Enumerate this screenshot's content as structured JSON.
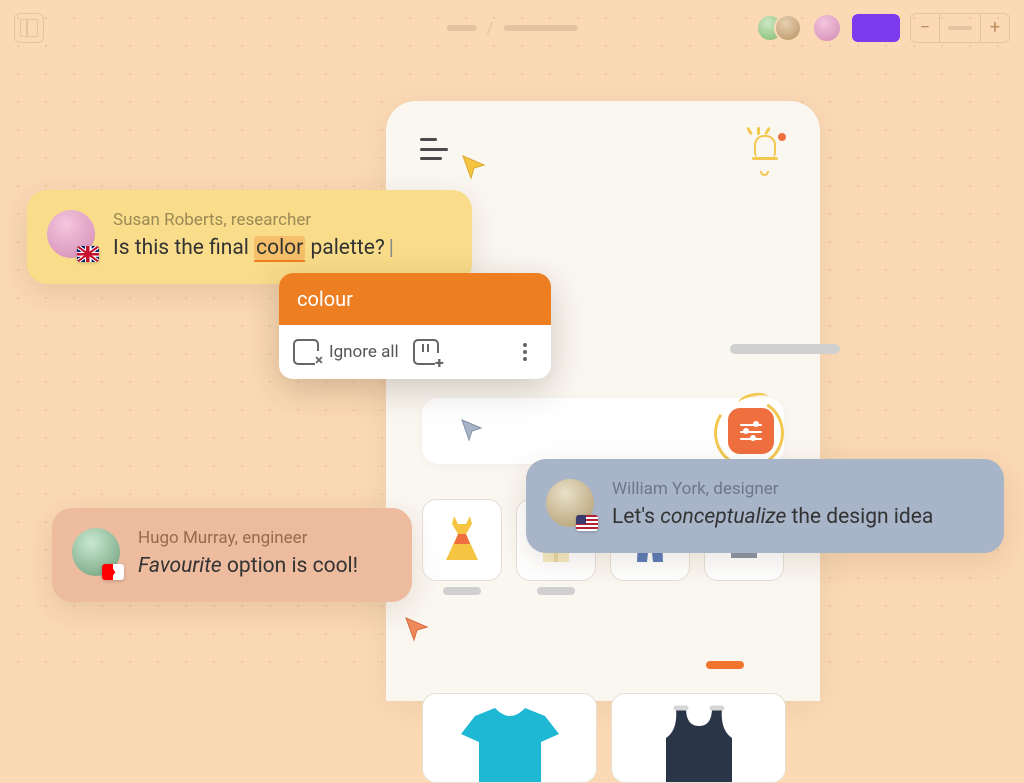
{
  "topbar": {
    "breadcrumb_separator": "/"
  },
  "comments": {
    "susan": {
      "name": "Susan Roberts",
      "role": "researcher",
      "meta": "Susan Roberts, researcher",
      "text_before": "Is this the final ",
      "word": "color",
      "text_after": " palette?",
      "flag": "uk"
    },
    "hugo": {
      "name": "Hugo Murray",
      "role": "engineer",
      "meta": "Hugo Murray, engineer",
      "em": "Favourite",
      "rest": " option is cool!",
      "flag": "ca"
    },
    "william": {
      "name": "William York",
      "role": "designer",
      "meta": "William York, designer",
      "before": "Let's ",
      "em": "conceptualize",
      "after": " the design idea",
      "flag": "us"
    }
  },
  "suggestion": {
    "correction": "colour",
    "ignore_all": "Ignore all"
  }
}
